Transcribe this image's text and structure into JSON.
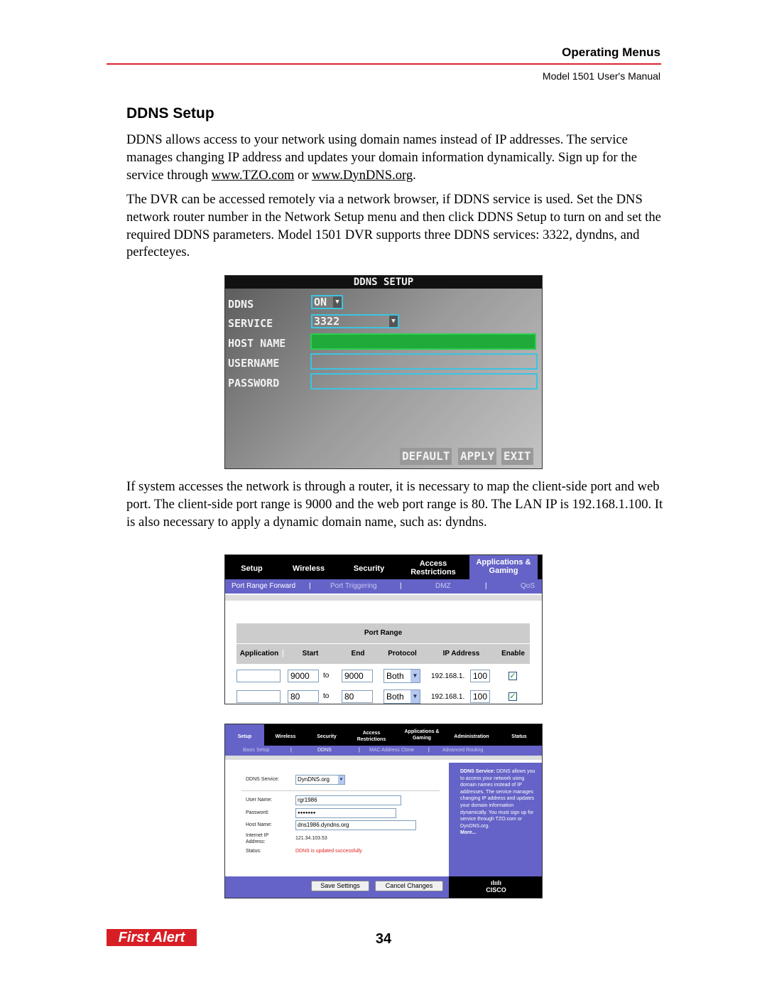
{
  "header": {
    "title": "Operating Menus",
    "subtitle": "Model 1501 User's Manual"
  },
  "section_title": "DDNS Setup",
  "para1": {
    "text": "DDNS allows access to your network using domain names instead of IP addresses. The service manages changing IP address and updates your domain information dynamically. Sign up for the service through ",
    "link1": "www.TZO.com",
    "or": " or ",
    "link2": "www.DynDNS.org",
    "end": "."
  },
  "para2": "The DVR can be accessed remotely via a network browser, if DDNS service is used. Set the DNS network router number in the Network Setup menu and then click DDNS Setup to turn on and set the required DDNS parameters. Model 1501 DVR supports three DDNS services: 3322, dyndns, and perfecteyes.",
  "para3": "If system accesses the network is through a router, it is necessary to map the client-side port and web port. The client-side port range is 9000 and the web port range is 80. The LAN IP is 192.168.1.100. It is also necessary to apply a dynamic domain name, such as: dyndns.",
  "dvr": {
    "title": "DDNS SETUP",
    "labels": [
      "DDNS",
      "SERVICE",
      "HOST NAME",
      "USERNAME",
      "PASSWORD"
    ],
    "ddns_value": "ON",
    "service_value": "3322",
    "buttons": [
      "DEFAULT",
      "APPLY",
      "EXIT"
    ],
    "highlight_color": "#1faa3a"
  },
  "router1": {
    "tabs": [
      "Setup",
      "Wireless",
      "Security",
      "Access Restrictions",
      "Applications & Gaming"
    ],
    "subtabs": [
      "Port Range Forward",
      "Port Triggering",
      "DMZ",
      "QoS"
    ],
    "table_title": "Port Range",
    "columns": [
      "Application",
      "Start",
      "End",
      "Protocol",
      "IP Address",
      "Enable"
    ],
    "rows": [
      {
        "app": "",
        "start": "9000",
        "to": "to",
        "end": "9000",
        "protocol": "Both",
        "ip_prefix": "192.168.1.",
        "ip_last": "100",
        "enabled": true
      },
      {
        "app": "",
        "start": "80",
        "to": "to",
        "end": "80",
        "protocol": "Both",
        "ip_prefix": "192.168.1.",
        "ip_last": "100",
        "enabled": true
      }
    ]
  },
  "router2": {
    "tabs": [
      "Setup",
      "Wireless",
      "Security",
      "Access Restrictions",
      "Applications & Gaming",
      "Administration",
      "Status"
    ],
    "subtabs": [
      "Basic Setup",
      "DDNS",
      "MAC Address Clone",
      "Advanced Routing"
    ],
    "fields": {
      "service_label": "DDNS Service:",
      "service_value": "DynDNS.org",
      "user_label": "User Name:",
      "user_value": "rgr1986",
      "pass_label": "Password:",
      "pass_value": "●●●●●●●",
      "host_label": "Host Name:",
      "host_value": "dns1986.dyndns.org",
      "ip_label": "Internet IP Address:",
      "ip_value": "121.34.103.53",
      "status_label": "Status:",
      "status_value": "DDNS is updated successfully"
    },
    "help_title": "DDNS Service:",
    "help_text": " DDNS allows you to access your network using domain names instead of IP addresses. The service manages changing IP address and updates your domain information dynamically. You must sign up for service through TZO.com or DynDNS.org.",
    "help_more": "More...",
    "save": "Save Settings",
    "cancel": "Cancel Changes",
    "brand": "CISCO",
    "accent": "#6563c7"
  },
  "footer": {
    "logo": "First Alert",
    "page": "34"
  }
}
